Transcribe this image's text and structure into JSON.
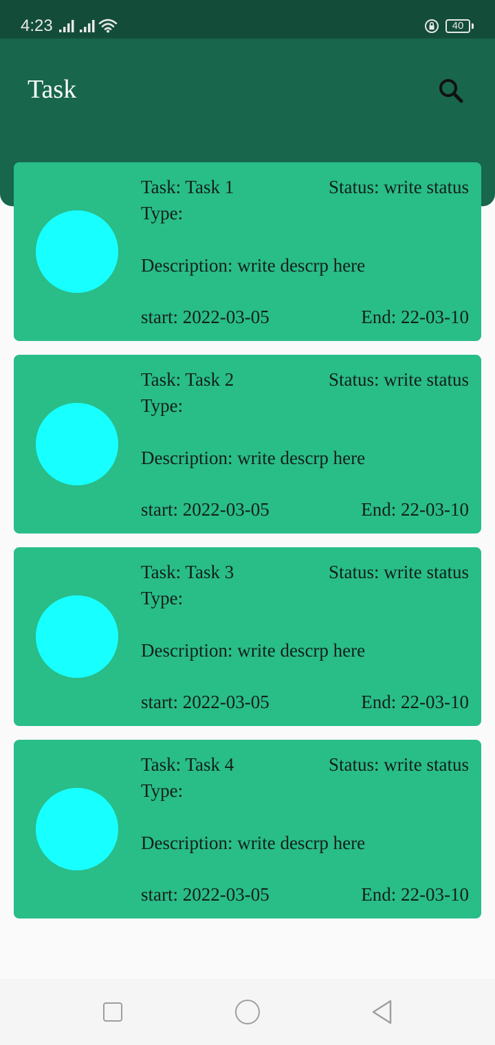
{
  "status_bar": {
    "time": "4:23",
    "battery": "40",
    "icons": [
      "signal-icon",
      "signal-icon",
      "wifi-icon",
      "rotation-lock-icon",
      "battery-icon"
    ]
  },
  "app_bar": {
    "title": "Task",
    "search_icon": "search-icon"
  },
  "colors": {
    "status_bar": "#134d3a",
    "app_bar": "#18664b",
    "card": "#29bd88",
    "avatar": "#18ffff",
    "background": "#fafafa"
  },
  "tasks": [
    {
      "name": "Task: Task 1",
      "status": "Status: write status",
      "type": "Type:",
      "description": "Description: write descrp here",
      "start": "start: 2022-03-05",
      "end": "End: 22-03-10"
    },
    {
      "name": "Task: Task 2",
      "status": "Status: write status",
      "type": "Type:",
      "description": "Description: write descrp here",
      "start": "start: 2022-03-05",
      "end": "End: 22-03-10"
    },
    {
      "name": "Task: Task 3",
      "status": "Status: write status",
      "type": "Type:",
      "description": "Description: write descrp here",
      "start": "start: 2022-03-05",
      "end": "End: 22-03-10"
    },
    {
      "name": "Task: Task 4",
      "status": "Status: write status",
      "type": "Type:",
      "description": "Description: write descrp here",
      "start": "start: 2022-03-05",
      "end": "End: 22-03-10"
    }
  ],
  "nav_bar": {
    "icons": [
      "recent-apps-icon",
      "home-icon",
      "back-icon"
    ]
  }
}
